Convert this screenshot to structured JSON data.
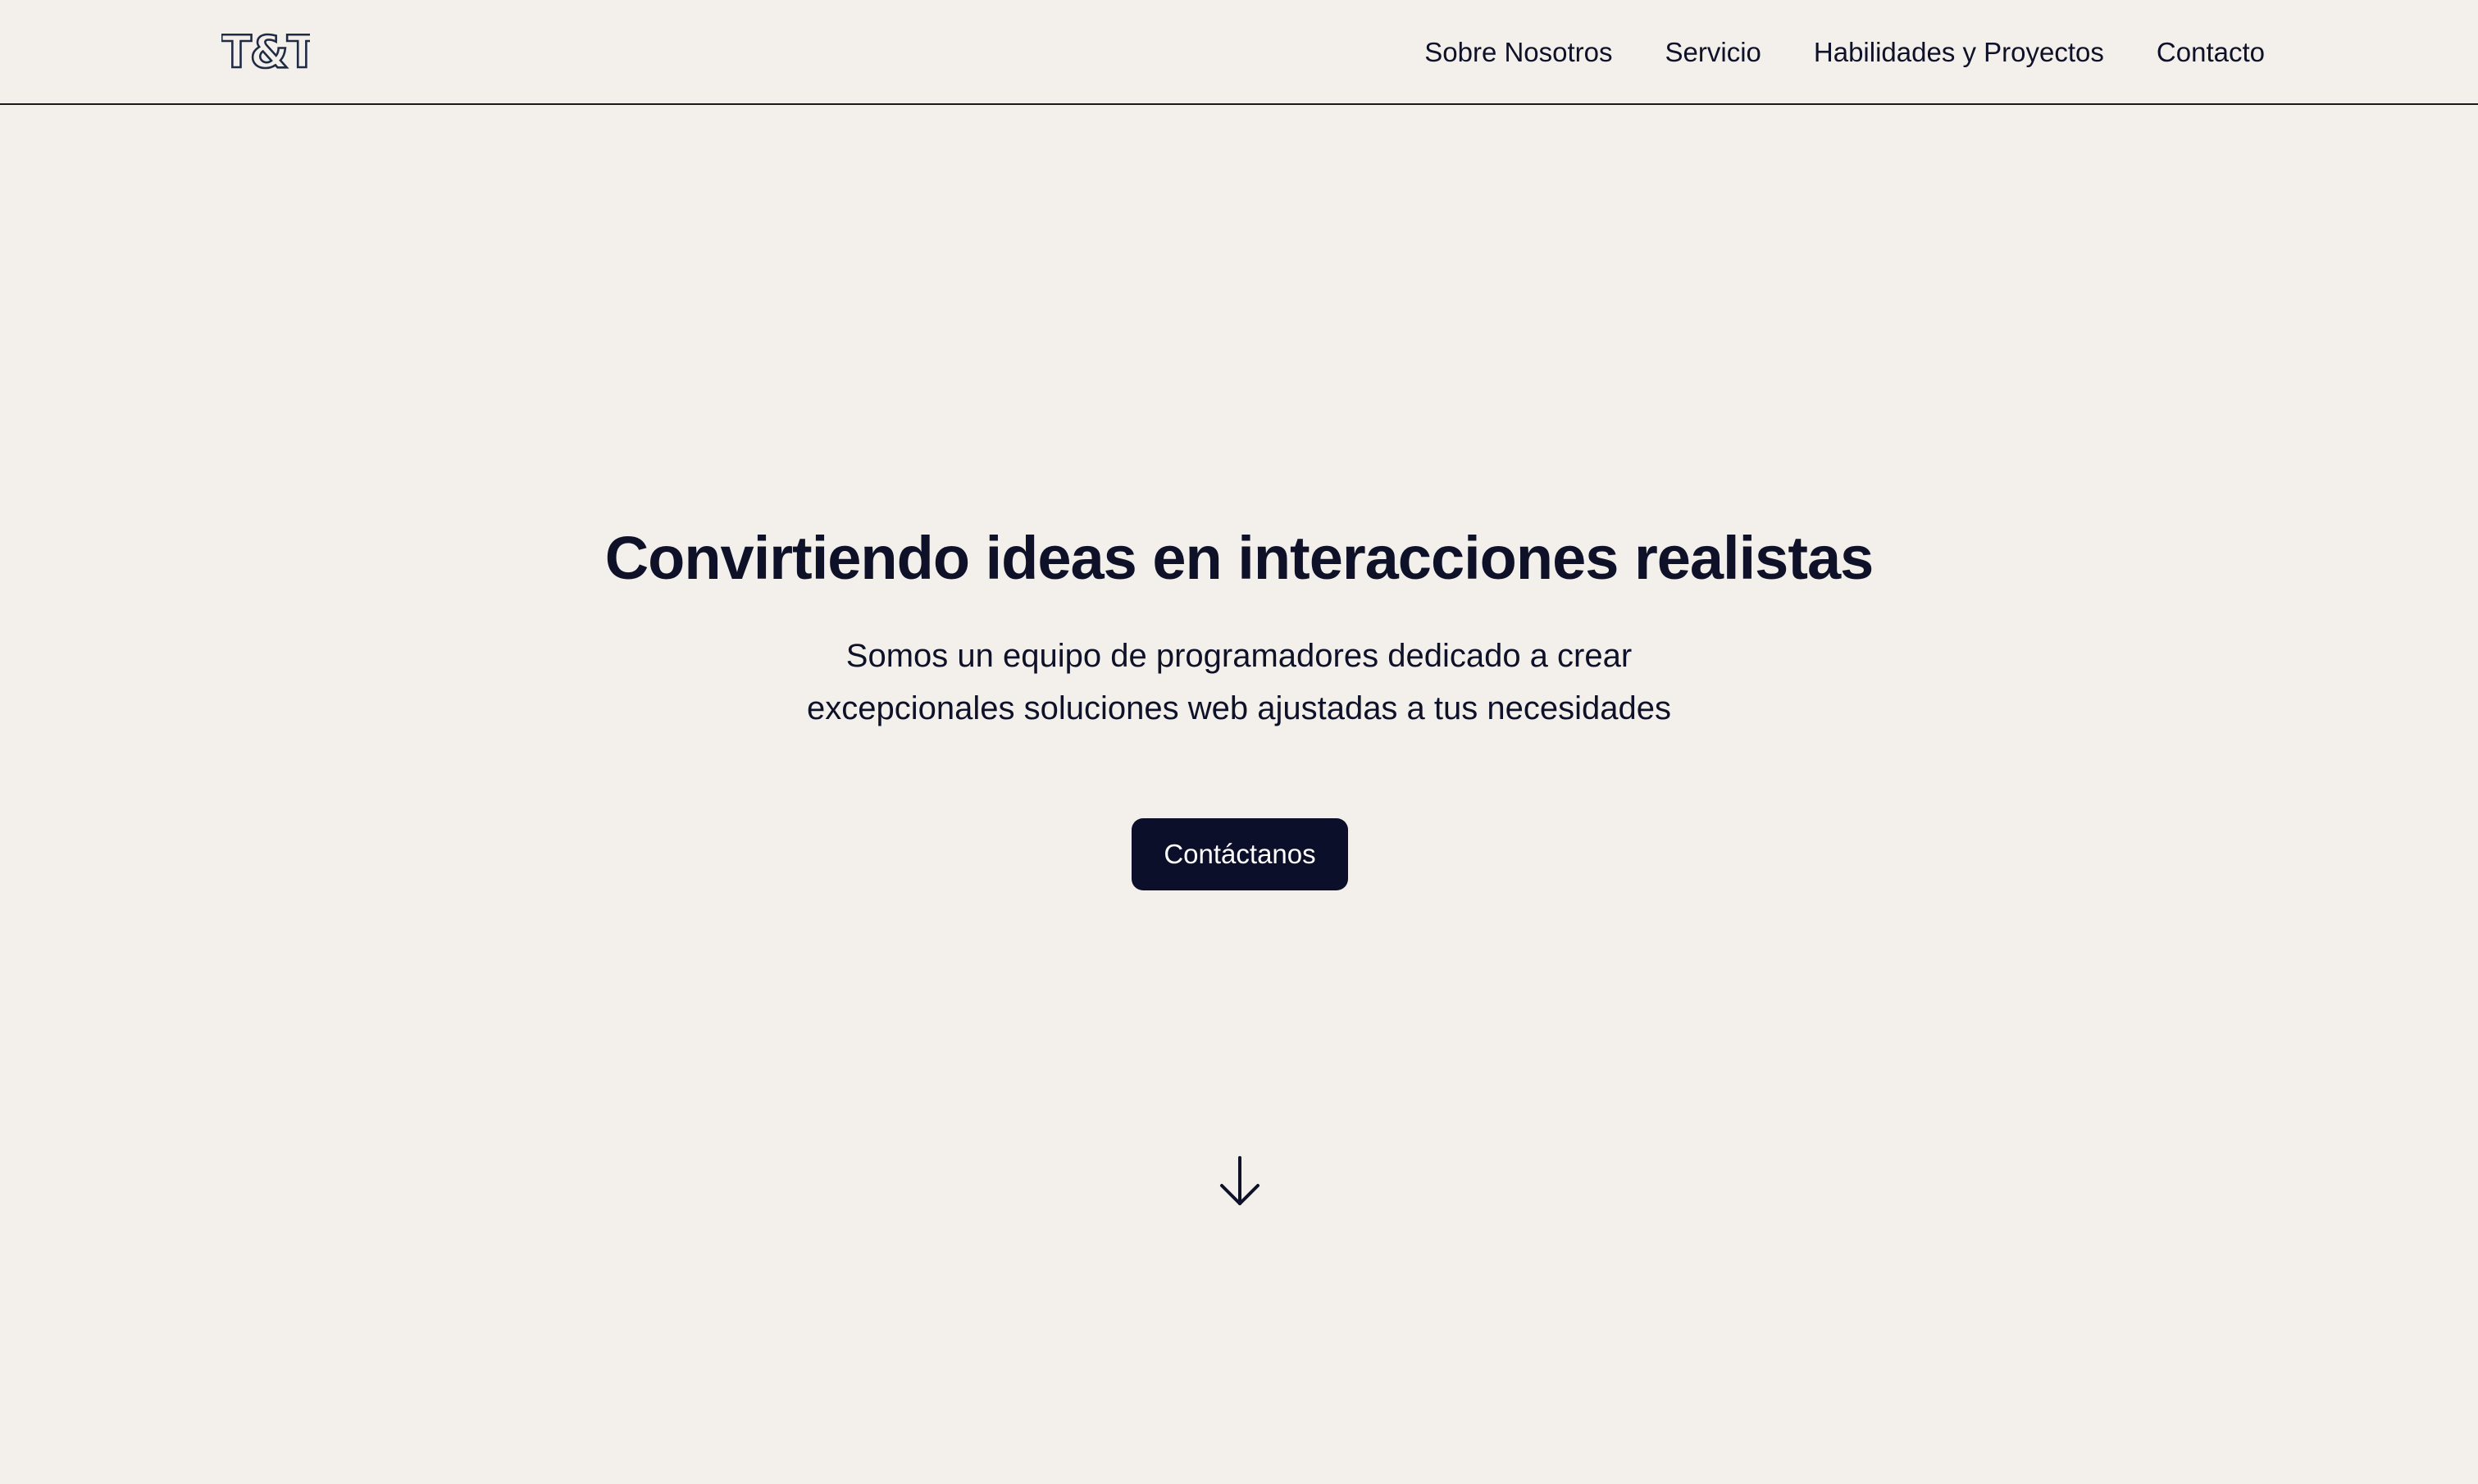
{
  "navbar": {
    "logo_text": "T&T",
    "links": [
      {
        "label": "Sobre Nosotros"
      },
      {
        "label": "Servicio"
      },
      {
        "label": "Habilidades y Proyectos"
      },
      {
        "label": "Contacto"
      }
    ]
  },
  "hero": {
    "title": "Convirtiendo ideas en interacciones realistas",
    "subtitle_line1": "Somos un equipo de programadores dedicado a crear",
    "subtitle_line2": "excepcionales soluciones web ajustadas a tus necesidades",
    "cta_label": "Contáctanos",
    "scroll_icon": "arrow-down-icon"
  },
  "colors": {
    "background": "#f3f0eb",
    "text": "#0e1128",
    "button": "#0c0f2a",
    "button_text": "#ffffff"
  }
}
